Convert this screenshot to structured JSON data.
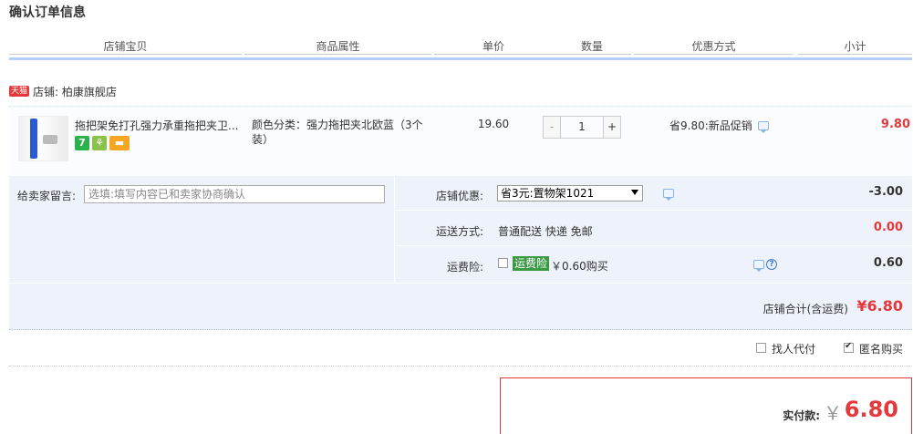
{
  "page": {
    "title": "确认订单信息"
  },
  "columns": [
    "店铺宝贝",
    "商品属性",
    "单价",
    "数量",
    "优惠方式",
    "小计"
  ],
  "shop": {
    "badge": "天猫",
    "label": "店铺: 柏康旗舰店"
  },
  "item": {
    "title": "拖把架免打孔强力承重拖把夹卫...",
    "icons": [
      "seven-day-return-icon",
      "guarantee-icon",
      "credit-card-icon"
    ],
    "icon_7": "7",
    "attr": "颜色分类：强力拖把夹北欧蓝（3个装）",
    "price": "19.60",
    "qty_minus": "-",
    "qty": "1",
    "qty_plus": "+",
    "promo": "省9.80:新品促销",
    "subtotal": "9.80"
  },
  "note": {
    "label": "给卖家留言:",
    "placeholder": "选填:填写内容已和卖家协商确认"
  },
  "options": {
    "discount_label": "店铺优惠:",
    "discount_select": "省3元:置物架1021",
    "discount_val": "-3.00",
    "ship_label": "运送方式:",
    "ship_text": "普通配送 快递 免邮",
    "ship_val": "0.00",
    "ins_label": "运费险:",
    "ins_badge": "运费险",
    "ins_text": "￥0.60购买",
    "ins_val": "0.60"
  },
  "shop_total": {
    "label": "店铺合计(含运费)",
    "value": "¥6.80"
  },
  "extra": {
    "proxy_pay": "找人代付",
    "anonymous": "匿名购买"
  },
  "payment": {
    "label": "实付款:",
    "yen": "￥",
    "value": "6.80"
  },
  "colors": {
    "accent_red": "#e4393c",
    "header_line": "#b2d1ff",
    "panel_bg": "#eef3fb"
  }
}
